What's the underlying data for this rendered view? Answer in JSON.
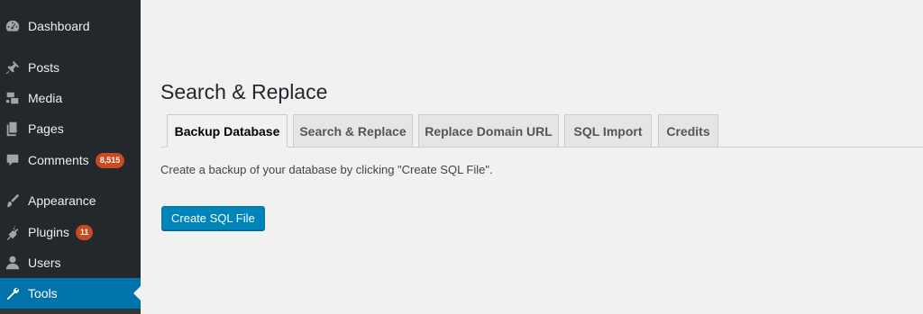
{
  "sidebar": {
    "items": [
      {
        "label": "Dashboard",
        "icon": "dashboard-icon"
      },
      {
        "label": "Posts",
        "icon": "pin-icon"
      },
      {
        "label": "Media",
        "icon": "media-icon"
      },
      {
        "label": "Pages",
        "icon": "pages-icon"
      },
      {
        "label": "Comments",
        "icon": "comment-icon",
        "badge": "8,515"
      },
      {
        "label": "Appearance",
        "icon": "paintbrush-icon"
      },
      {
        "label": "Plugins",
        "icon": "plugin-icon",
        "badge": "11"
      },
      {
        "label": "Users",
        "icon": "user-icon"
      },
      {
        "label": "Tools",
        "icon": "wrench-icon",
        "current": true
      }
    ]
  },
  "page": {
    "title": "Search & Replace",
    "tabs": [
      {
        "label": "Backup Database",
        "active": true
      },
      {
        "label": "Search & Replace"
      },
      {
        "label": "Replace Domain URL"
      },
      {
        "label": "SQL Import"
      },
      {
        "label": "Credits"
      }
    ],
    "description": "Create a backup of your database by clicking \"Create SQL File\".",
    "button_label": "Create SQL File"
  },
  "colors": {
    "sidebar_bg": "#23282d",
    "accent": "#0073aa",
    "button": "#0085ba",
    "badge": "#ca4a1f",
    "page_bg": "#f1f1f1"
  }
}
